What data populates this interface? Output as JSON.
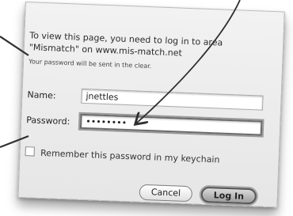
{
  "dialog": {
    "message_line1": "To view this page, you need to log in to area",
    "message_line2": "\"Mismatch\" on www.mis-match.net",
    "subtext": "Your password will be sent in the clear.",
    "name_label": "Name:",
    "name_value": "jnettles",
    "password_label": "Password:",
    "password_value": "••••••••",
    "remember_label": "Remember this password in my keychain",
    "cancel_label": "Cancel",
    "login_label": "Log In"
  },
  "icons": {
    "checkbox": "checkbox-icon",
    "arrow": "annotation-arrow-icon"
  }
}
